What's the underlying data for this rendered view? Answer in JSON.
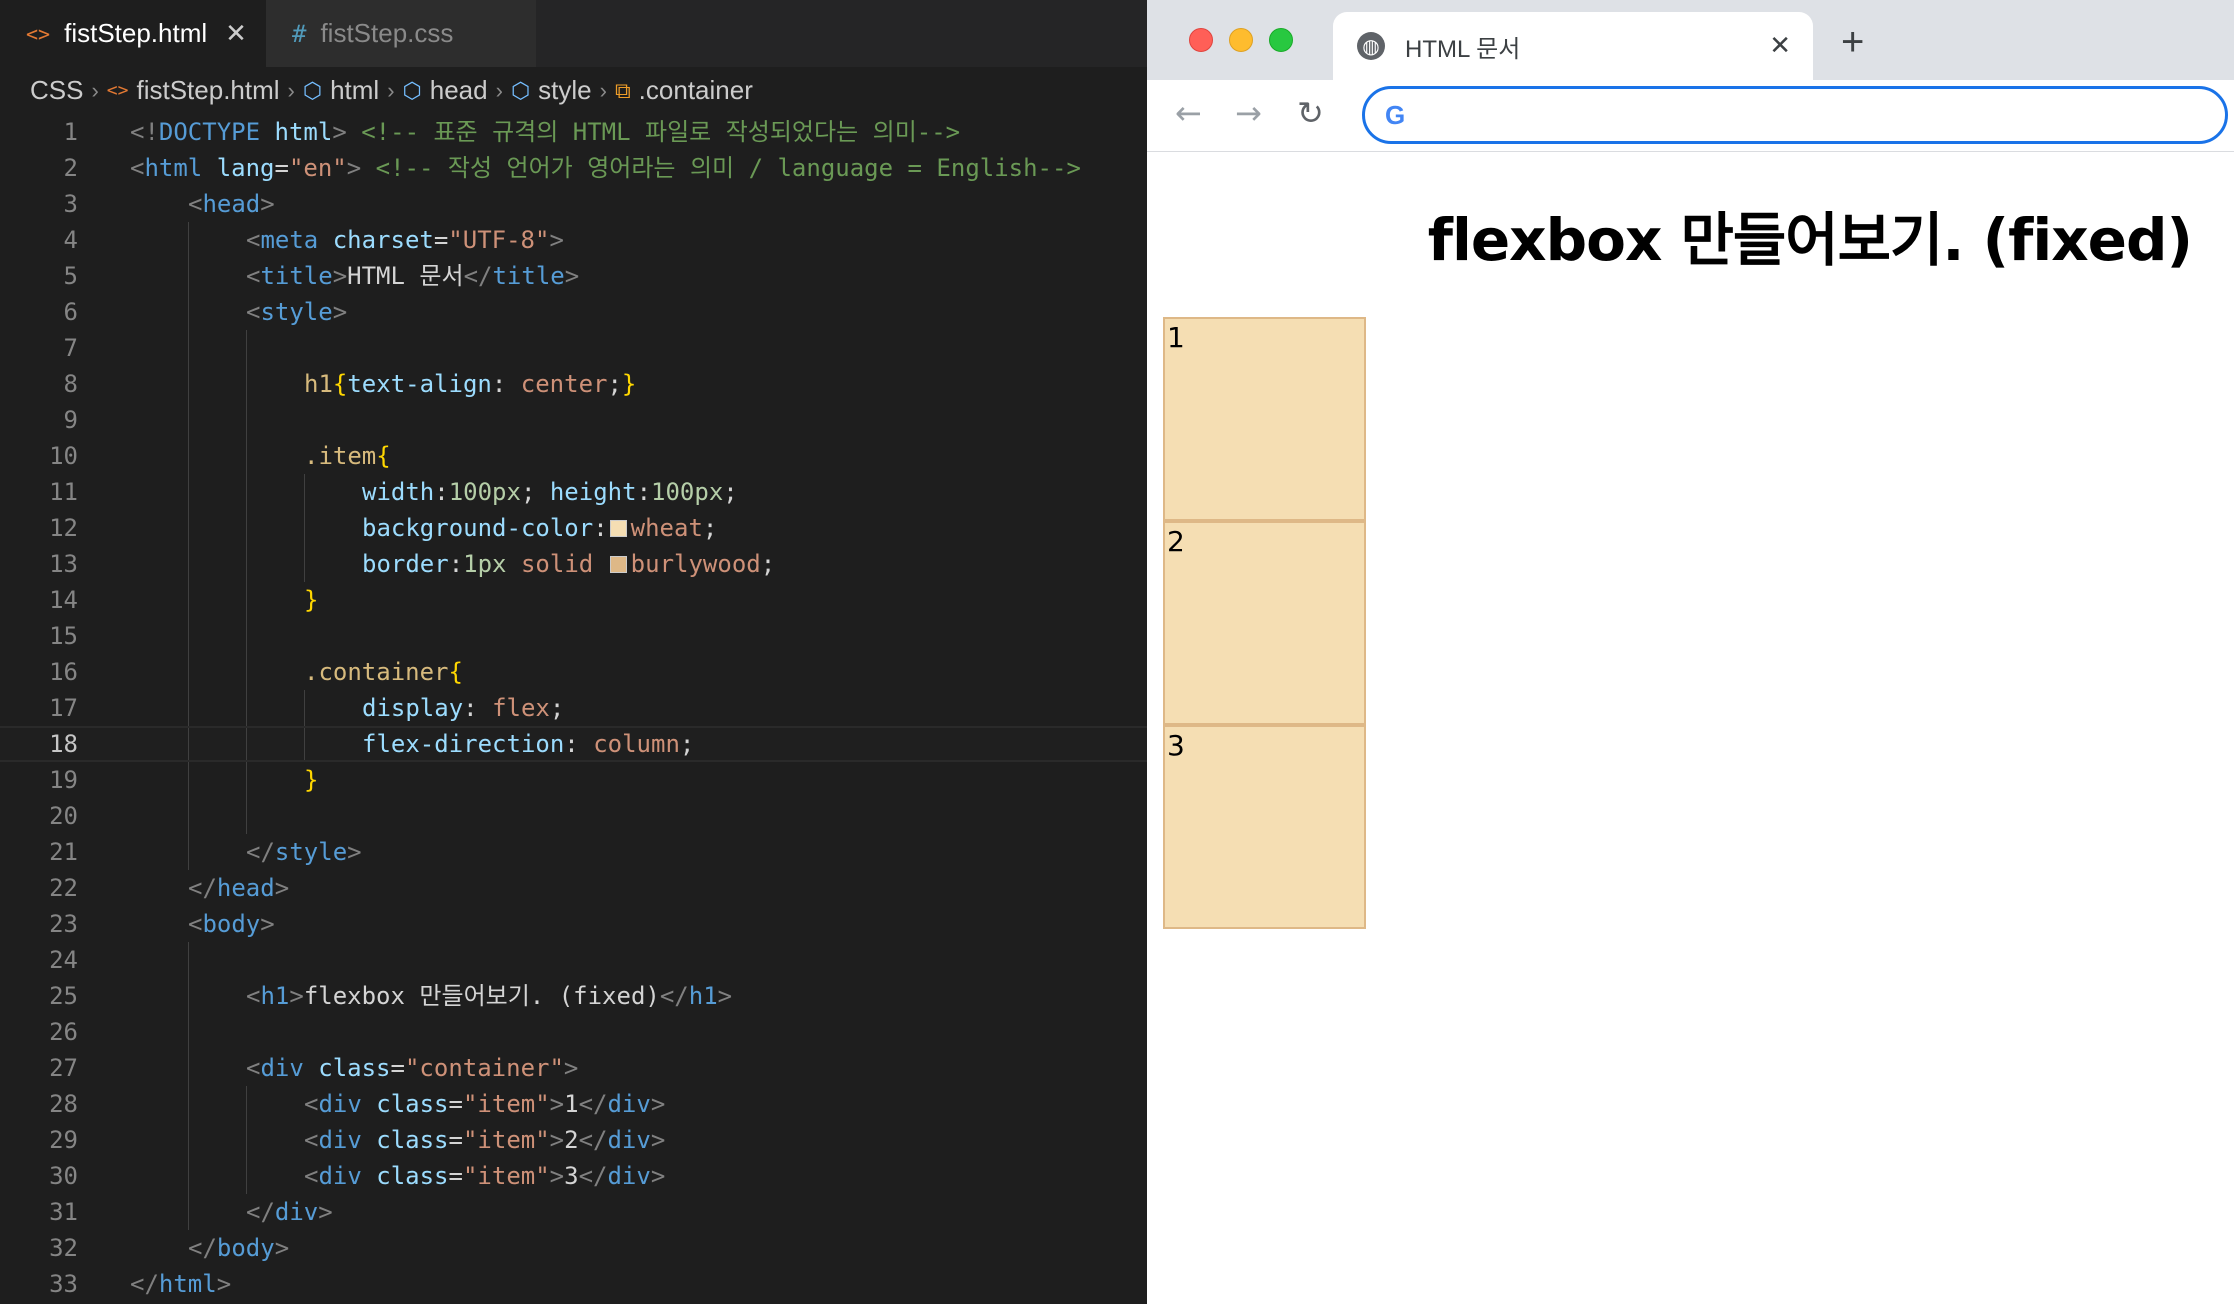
{
  "editor": {
    "tabs": [
      {
        "label": "fistStep.html",
        "active": true
      },
      {
        "label": "fistStep.css",
        "active": false
      }
    ],
    "breadcrumb": [
      "CSS",
      "fistStep.html",
      "html",
      "head",
      "style",
      ".container"
    ],
    "current_line": 18,
    "lines": [
      {
        "n": 1,
        "indent": 0
      },
      {
        "n": 2,
        "indent": 0
      },
      {
        "n": 3,
        "indent": 1
      },
      {
        "n": 4,
        "indent": 2
      },
      {
        "n": 5,
        "indent": 2
      },
      {
        "n": 6,
        "indent": 2
      },
      {
        "n": 7,
        "indent": 0
      },
      {
        "n": 8,
        "indent": 3
      },
      {
        "n": 9,
        "indent": 0
      },
      {
        "n": 10,
        "indent": 3
      },
      {
        "n": 11,
        "indent": 4
      },
      {
        "n": 12,
        "indent": 4
      },
      {
        "n": 13,
        "indent": 4
      },
      {
        "n": 14,
        "indent": 3
      },
      {
        "n": 15,
        "indent": 0
      },
      {
        "n": 16,
        "indent": 3
      },
      {
        "n": 17,
        "indent": 4
      },
      {
        "n": 18,
        "indent": 4
      },
      {
        "n": 19,
        "indent": 3
      },
      {
        "n": 20,
        "indent": 0
      },
      {
        "n": 21,
        "indent": 2
      },
      {
        "n": 22,
        "indent": 1
      },
      {
        "n": 23,
        "indent": 1
      },
      {
        "n": 24,
        "indent": 0
      },
      {
        "n": 25,
        "indent": 2
      },
      {
        "n": 26,
        "indent": 0
      },
      {
        "n": 27,
        "indent": 2
      },
      {
        "n": 28,
        "indent": 3
      },
      {
        "n": 29,
        "indent": 3
      },
      {
        "n": 30,
        "indent": 3
      },
      {
        "n": 31,
        "indent": 2
      },
      {
        "n": 32,
        "indent": 1
      },
      {
        "n": 33,
        "indent": 0
      }
    ],
    "code": {
      "l1": {
        "a": "<!",
        "b": "DOCTYPE",
        "c": " html",
        "d": ">",
        "e": " <!-- 표준 규격의 HTML 파일로 작성되었다는 의미-->"
      },
      "l2": {
        "a": "<",
        "b": "html",
        "c": " lang",
        "d": "=",
        "e": "\"en\"",
        "f": ">",
        "g": " <!-- 작성 언어가 영어라는 의미 / language = English-->"
      },
      "l3": {
        "a": "<",
        "b": "head",
        "c": ">"
      },
      "l4": {
        "a": "<",
        "b": "meta",
        "c": " charset",
        "d": "=",
        "e": "\"UTF-8\"",
        "f": ">"
      },
      "l5": {
        "a": "<",
        "b": "title",
        "c": ">",
        "d": "HTML 문서",
        "e": "</",
        "f": "title",
        "g": ">"
      },
      "l6": {
        "a": "<",
        "b": "style",
        "c": ">"
      },
      "l8": {
        "a": "h1",
        "b": "{",
        "c": "text-align",
        "d": ": ",
        "e": "center",
        "f": ";",
        "g": "}"
      },
      "l10": {
        "a": ".item",
        "b": "{"
      },
      "l11": {
        "a": "width",
        "b": ":",
        "c": "100px",
        "d": "; ",
        "e": "height",
        "f": ":",
        "g": "100px",
        "h": ";"
      },
      "l12": {
        "a": "background-color",
        "b": ":",
        "c": "wheat",
        "d": ";",
        "swatch": "#f5deb3"
      },
      "l13": {
        "a": "border",
        "b": ":",
        "c": "1px",
        "d": " solid ",
        "e": "burlywood",
        "f": ";",
        "swatch": "#deb887"
      },
      "l14": {
        "a": "}"
      },
      "l16": {
        "a": ".container",
        "b": "{"
      },
      "l17": {
        "a": "display",
        "b": ": ",
        "c": "flex",
        "d": ";"
      },
      "l18": {
        "a": "flex-direction",
        "b": ": ",
        "c": "column",
        "d": ";"
      },
      "l19": {
        "a": "}"
      },
      "l21": {
        "a": "</",
        "b": "style",
        "c": ">"
      },
      "l22": {
        "a": "</",
        "b": "head",
        "c": ">"
      },
      "l23": {
        "a": "<",
        "b": "body",
        "c": ">"
      },
      "l25": {
        "a": "<",
        "b": "h1",
        "c": ">",
        "d": "flexbox 만들어보기. (fixed)",
        "e": "</",
        "f": "h1",
        "g": ">"
      },
      "l27": {
        "a": "<",
        "b": "div",
        "c": " class",
        "d": "=",
        "e": "\"container\"",
        "f": ">"
      },
      "l28": {
        "a": "<",
        "b": "div",
        "c": " class",
        "d": "=",
        "e": "\"item\"",
        "f": ">",
        "g": "1",
        "h": "</",
        "i": "div",
        "j": ">"
      },
      "l29": {
        "a": "<",
        "b": "div",
        "c": " class",
        "d": "=",
        "e": "\"item\"",
        "f": ">",
        "g": "2",
        "h": "</",
        "i": "div",
        "j": ">"
      },
      "l30": {
        "a": "<",
        "b": "div",
        "c": " class",
        "d": "=",
        "e": "\"item\"",
        "f": ">",
        "g": "3",
        "h": "</",
        "i": "div",
        "j": ">"
      },
      "l31": {
        "a": "</",
        "b": "div",
        "c": ">"
      },
      "l32": {
        "a": "</",
        "b": "body",
        "c": ">"
      },
      "l33": {
        "a": "</",
        "b": "html",
        "c": ">"
      }
    }
  },
  "browser": {
    "tab_title": "HTML 문서",
    "tab_close": "✕",
    "new_tab": "+",
    "nav": {
      "back": "←",
      "forward": "→",
      "reload": "↻"
    },
    "address_value": "",
    "google_icon": "G",
    "page": {
      "h1": "flexbox 만들어보기. (fixed)",
      "items": [
        "1",
        "2",
        "3"
      ]
    }
  },
  "icons": {
    "html_file": "<>",
    "css_file": "#",
    "close": "✕",
    "chevron": "›",
    "element": "⬡",
    "class": "⧉",
    "globe": "◍"
  },
  "colors": {
    "wheat": "#f5deb3",
    "burlywood": "#deb887",
    "omnibox_focus": "#1a73e8"
  }
}
